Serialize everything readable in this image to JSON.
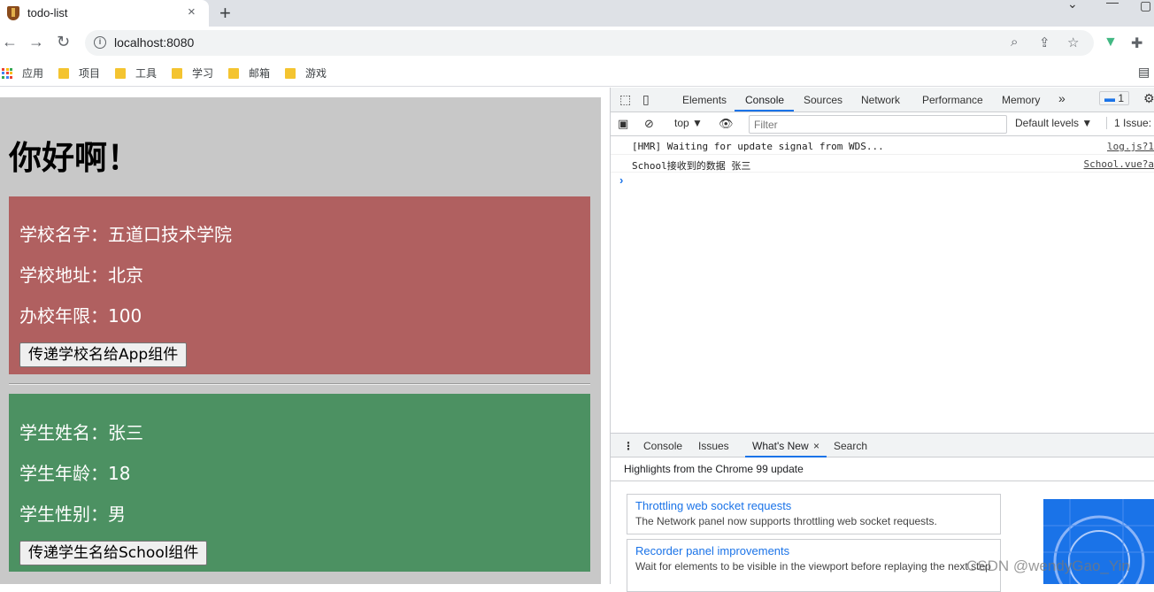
{
  "browser": {
    "tab_title": "todo-list",
    "tab_close": "×",
    "new_tab": "+",
    "back": "←",
    "forward": "→",
    "reload": "↻",
    "url": "localhost:8080",
    "bookmarks": [
      "应用",
      "项目",
      "工具",
      "学习",
      "邮箱",
      "游戏"
    ]
  },
  "app": {
    "heading": "你好啊！",
    "school": {
      "name_line": "学校名字：五道口技术学院",
      "address_line": "学校地址：北京",
      "years_line": "办校年限：100",
      "button": "传递学校名给App组件"
    },
    "student": {
      "name_line": "学生姓名：张三",
      "age_line": "学生年龄：18",
      "gender_line": "学生性别：男",
      "button": "传递学生名给School组件"
    }
  },
  "devtools": {
    "tabs": [
      "Elements",
      "Console",
      "Sources",
      "Network",
      "Performance",
      "Memory"
    ],
    "more": "»",
    "badge": "1",
    "toolbar": {
      "context": "top ▼",
      "filter_placeholder": "Filter",
      "levels": "Default levels ▼",
      "issues": "1 Issue:"
    },
    "logs": [
      {
        "message": "[HMR] Waiting for update signal from WDS...",
        "source": "log.js?1"
      },
      {
        "message": "School接收到的数据 张三",
        "source": "School.vue?a"
      }
    ],
    "prompt": "›",
    "drawer_tabs": [
      "Console",
      "Issues",
      "What's New",
      "Search"
    ],
    "drawer_close": "×",
    "highlights": "Highlights from the Chrome 99 update",
    "cards": [
      {
        "title": "Throttling web socket requests",
        "desc": "The Network panel now supports throttling web socket requests."
      },
      {
        "title": "Recorder panel improvements",
        "desc": "Wait for elements to be visible in the viewport before replaying the next step"
      }
    ]
  },
  "watermark": "CSDN @wendyGao_Yin",
  "colors": {
    "school_bg": "#b06060",
    "student_bg": "#4c9162",
    "app_bg": "#c8c8c8",
    "accent": "#1a73e8"
  }
}
